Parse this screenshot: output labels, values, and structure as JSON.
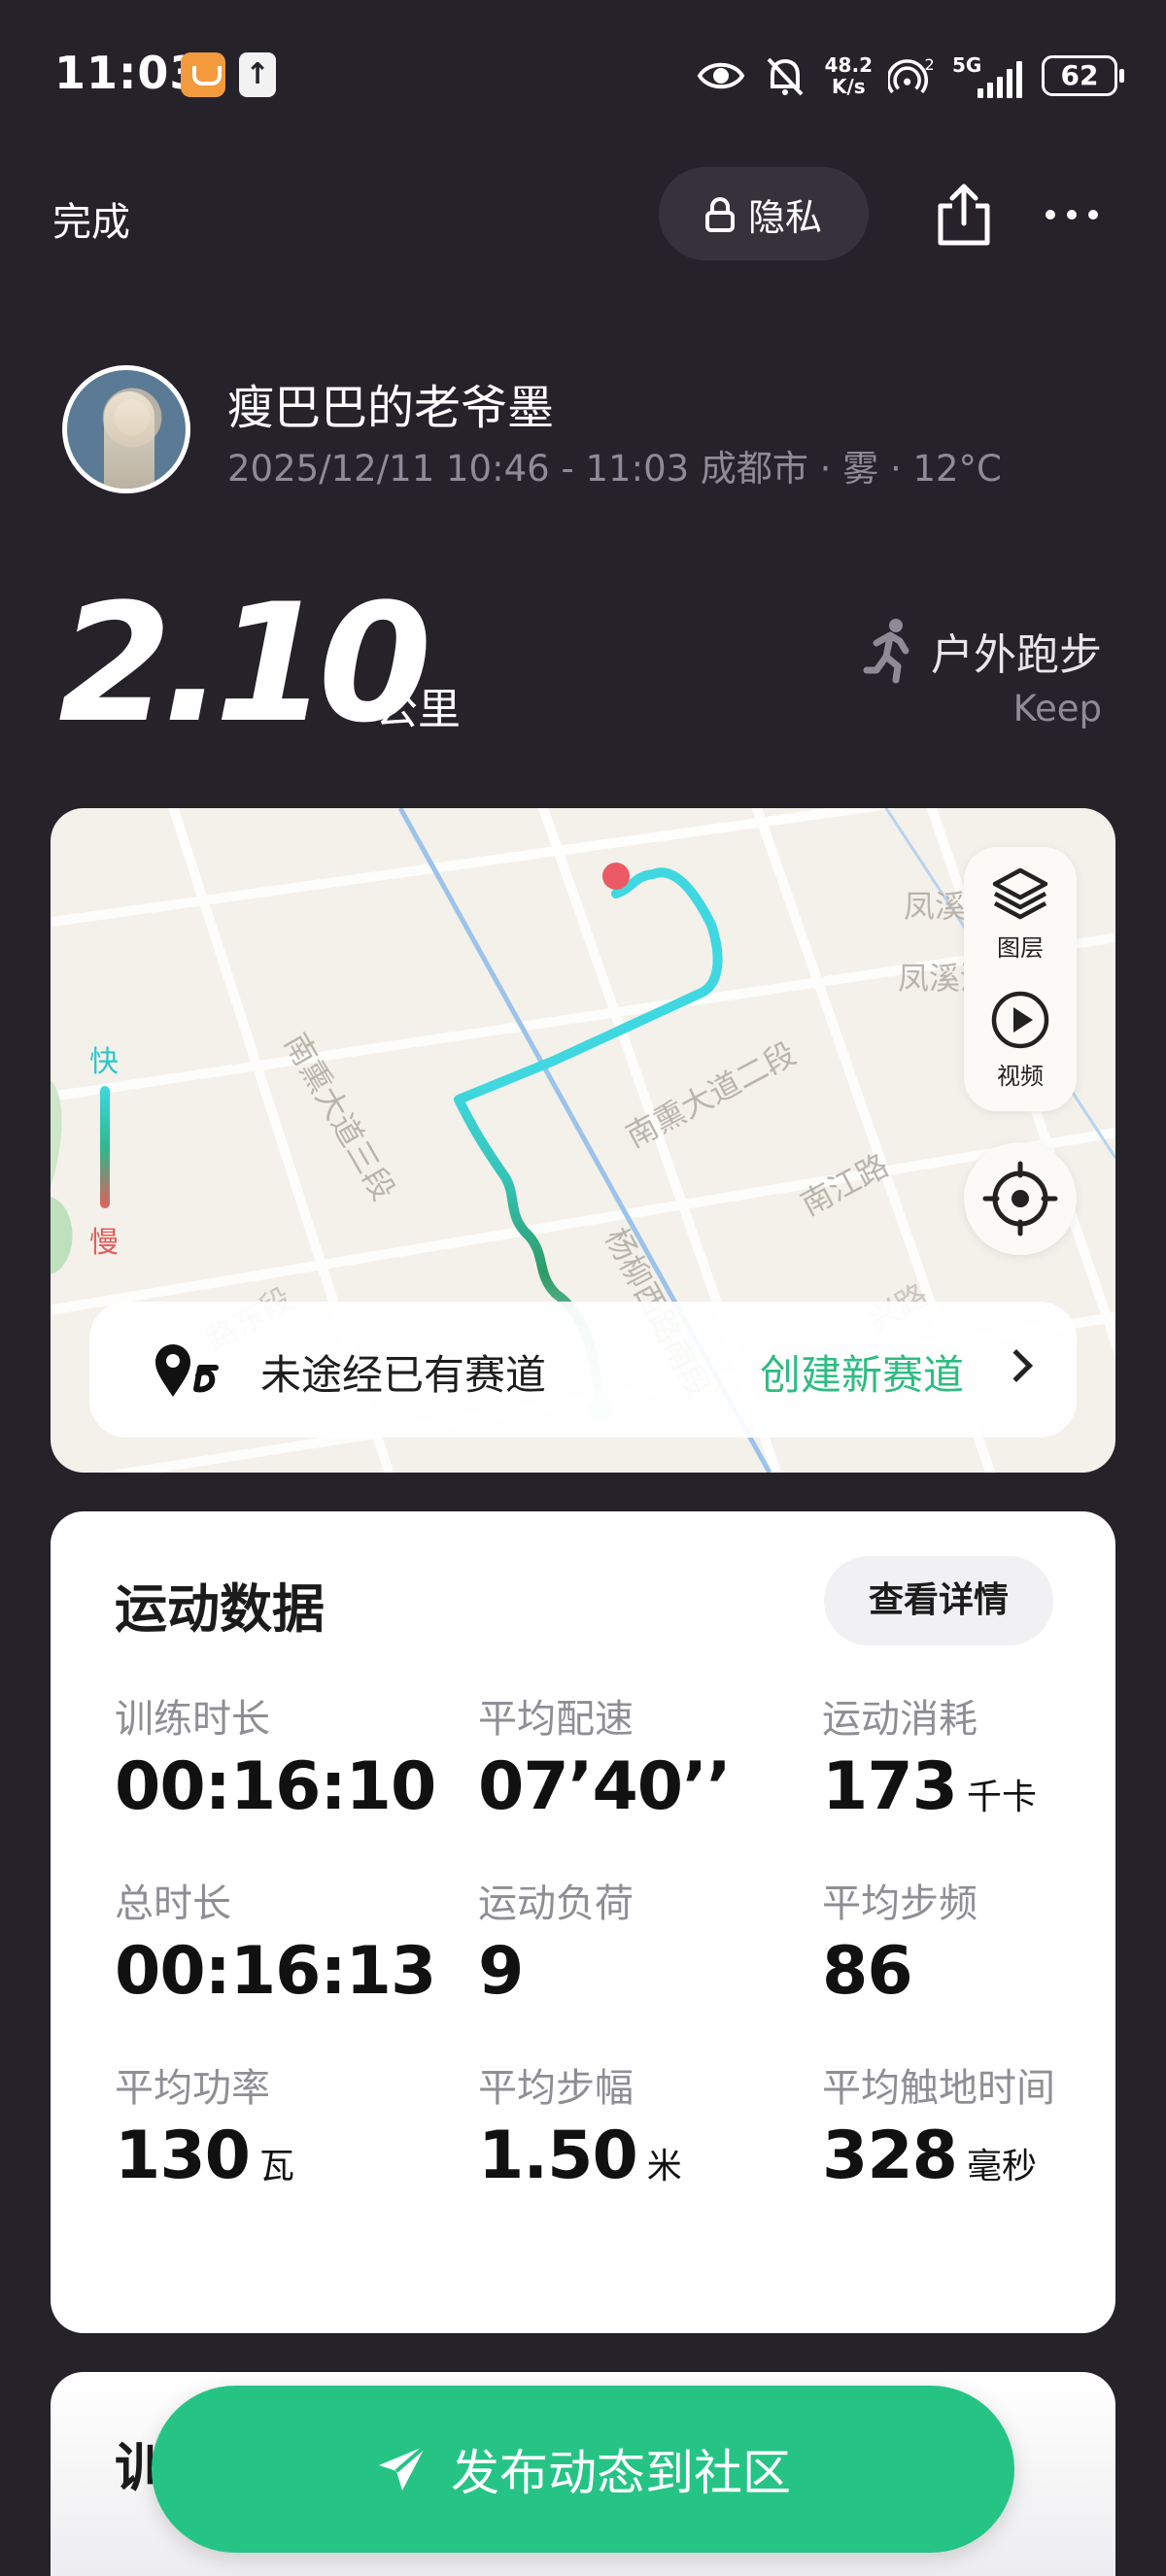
{
  "status_bar": {
    "time": "11:03",
    "net_speed_value": "48.2",
    "net_speed_unit": "K/s",
    "hotspot_count": "2",
    "network": "5G",
    "battery": "62"
  },
  "nav": {
    "done_label": "完成",
    "privacy_label": "隐私"
  },
  "profile": {
    "username": "瘦巴巴的老爷墨",
    "meta": "2025/12/11 10:46 - 11:03 成都市 · 雾 · 12°C"
  },
  "summary": {
    "distance": "2.10",
    "distance_unit": "公里",
    "sport_type": "户外跑步",
    "source": "Keep"
  },
  "map": {
    "labels": {
      "road_1": "南熏大道三段",
      "road_2": "南熏大道二段",
      "road_3": "南江路",
      "road_4": "杨柳西路南段",
      "road_5": "凤溪河",
      "road_6": "凤溪河",
      "road_7": "路东段",
      "road_8": "兴路"
    },
    "layers_label": "图层",
    "video_label": "视频",
    "legend_fast": "快",
    "legend_slow": "慢",
    "route_text": "未途经已有赛道",
    "route_link": "创建新赛道",
    "colors": {
      "route_fast": "#3fd8e0",
      "route_slow": "#2e9a67",
      "start_point": "#b9f0d5",
      "end_point": "#ec5a66"
    }
  },
  "stats": {
    "title": "运动数据",
    "detail_button": "查看详情",
    "items": [
      {
        "label": "训练时长",
        "value": "00:16:10",
        "unit": ""
      },
      {
        "label": "平均配速",
        "value": "07’40’’",
        "unit": ""
      },
      {
        "label": "运动消耗",
        "value": "173",
        "unit": "千卡"
      },
      {
        "label": "总时长",
        "value": "00:16:13",
        "unit": ""
      },
      {
        "label": "运动负荷",
        "value": "9",
        "unit": ""
      },
      {
        "label": "平均步频",
        "value": "86",
        "unit": ""
      },
      {
        "label": "平均功率",
        "value": "130",
        "unit": "瓦"
      },
      {
        "label": "平均步幅",
        "value": "1.50",
        "unit": "米"
      },
      {
        "label": "平均触地时间",
        "value": "328",
        "unit": "毫秒"
      }
    ]
  },
  "training": {
    "title": "训练"
  },
  "publish": {
    "label": "发布动态到社区",
    "color": "#25c485"
  }
}
